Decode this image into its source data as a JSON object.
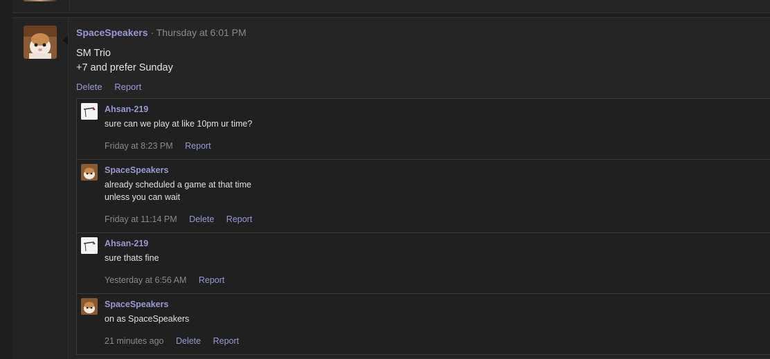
{
  "post": {
    "author": "SpaceSpeakers",
    "separator": "·",
    "time": "Thursday at 6:01 PM",
    "lines": [
      "SM Trio",
      "+7 and prefer Sunday"
    ],
    "actions": {
      "delete": "Delete",
      "report": "Report"
    }
  },
  "comments": [
    {
      "author": "Ahsan-219",
      "avatar": "sketch-avatar",
      "lines": [
        "sure can we play at like 10pm ur time?"
      ],
      "time": "Friday at 8:23 PM",
      "delete": "",
      "report": "Report"
    },
    {
      "author": "SpaceSpeakers",
      "avatar": "cat-avatar",
      "lines": [
        "already scheduled a game at that time",
        "unless you can wait"
      ],
      "time": "Friday at 11:14 PM",
      "delete": "Delete",
      "report": "Report"
    },
    {
      "author": "Ahsan-219",
      "avatar": "sketch-avatar",
      "lines": [
        "sure thats fine"
      ],
      "time": "Yesterday at 6:56 AM",
      "delete": "",
      "report": "Report"
    },
    {
      "author": "SpaceSpeakers",
      "avatar": "cat-avatar",
      "lines": [
        "on as SpaceSpeakers"
      ],
      "time": "21 minutes ago",
      "delete": "Delete",
      "report": "Report"
    }
  ],
  "colors": {
    "accent": "#9a98d4",
    "muted": "#8a8a8a",
    "background": "#1e1e1e"
  }
}
